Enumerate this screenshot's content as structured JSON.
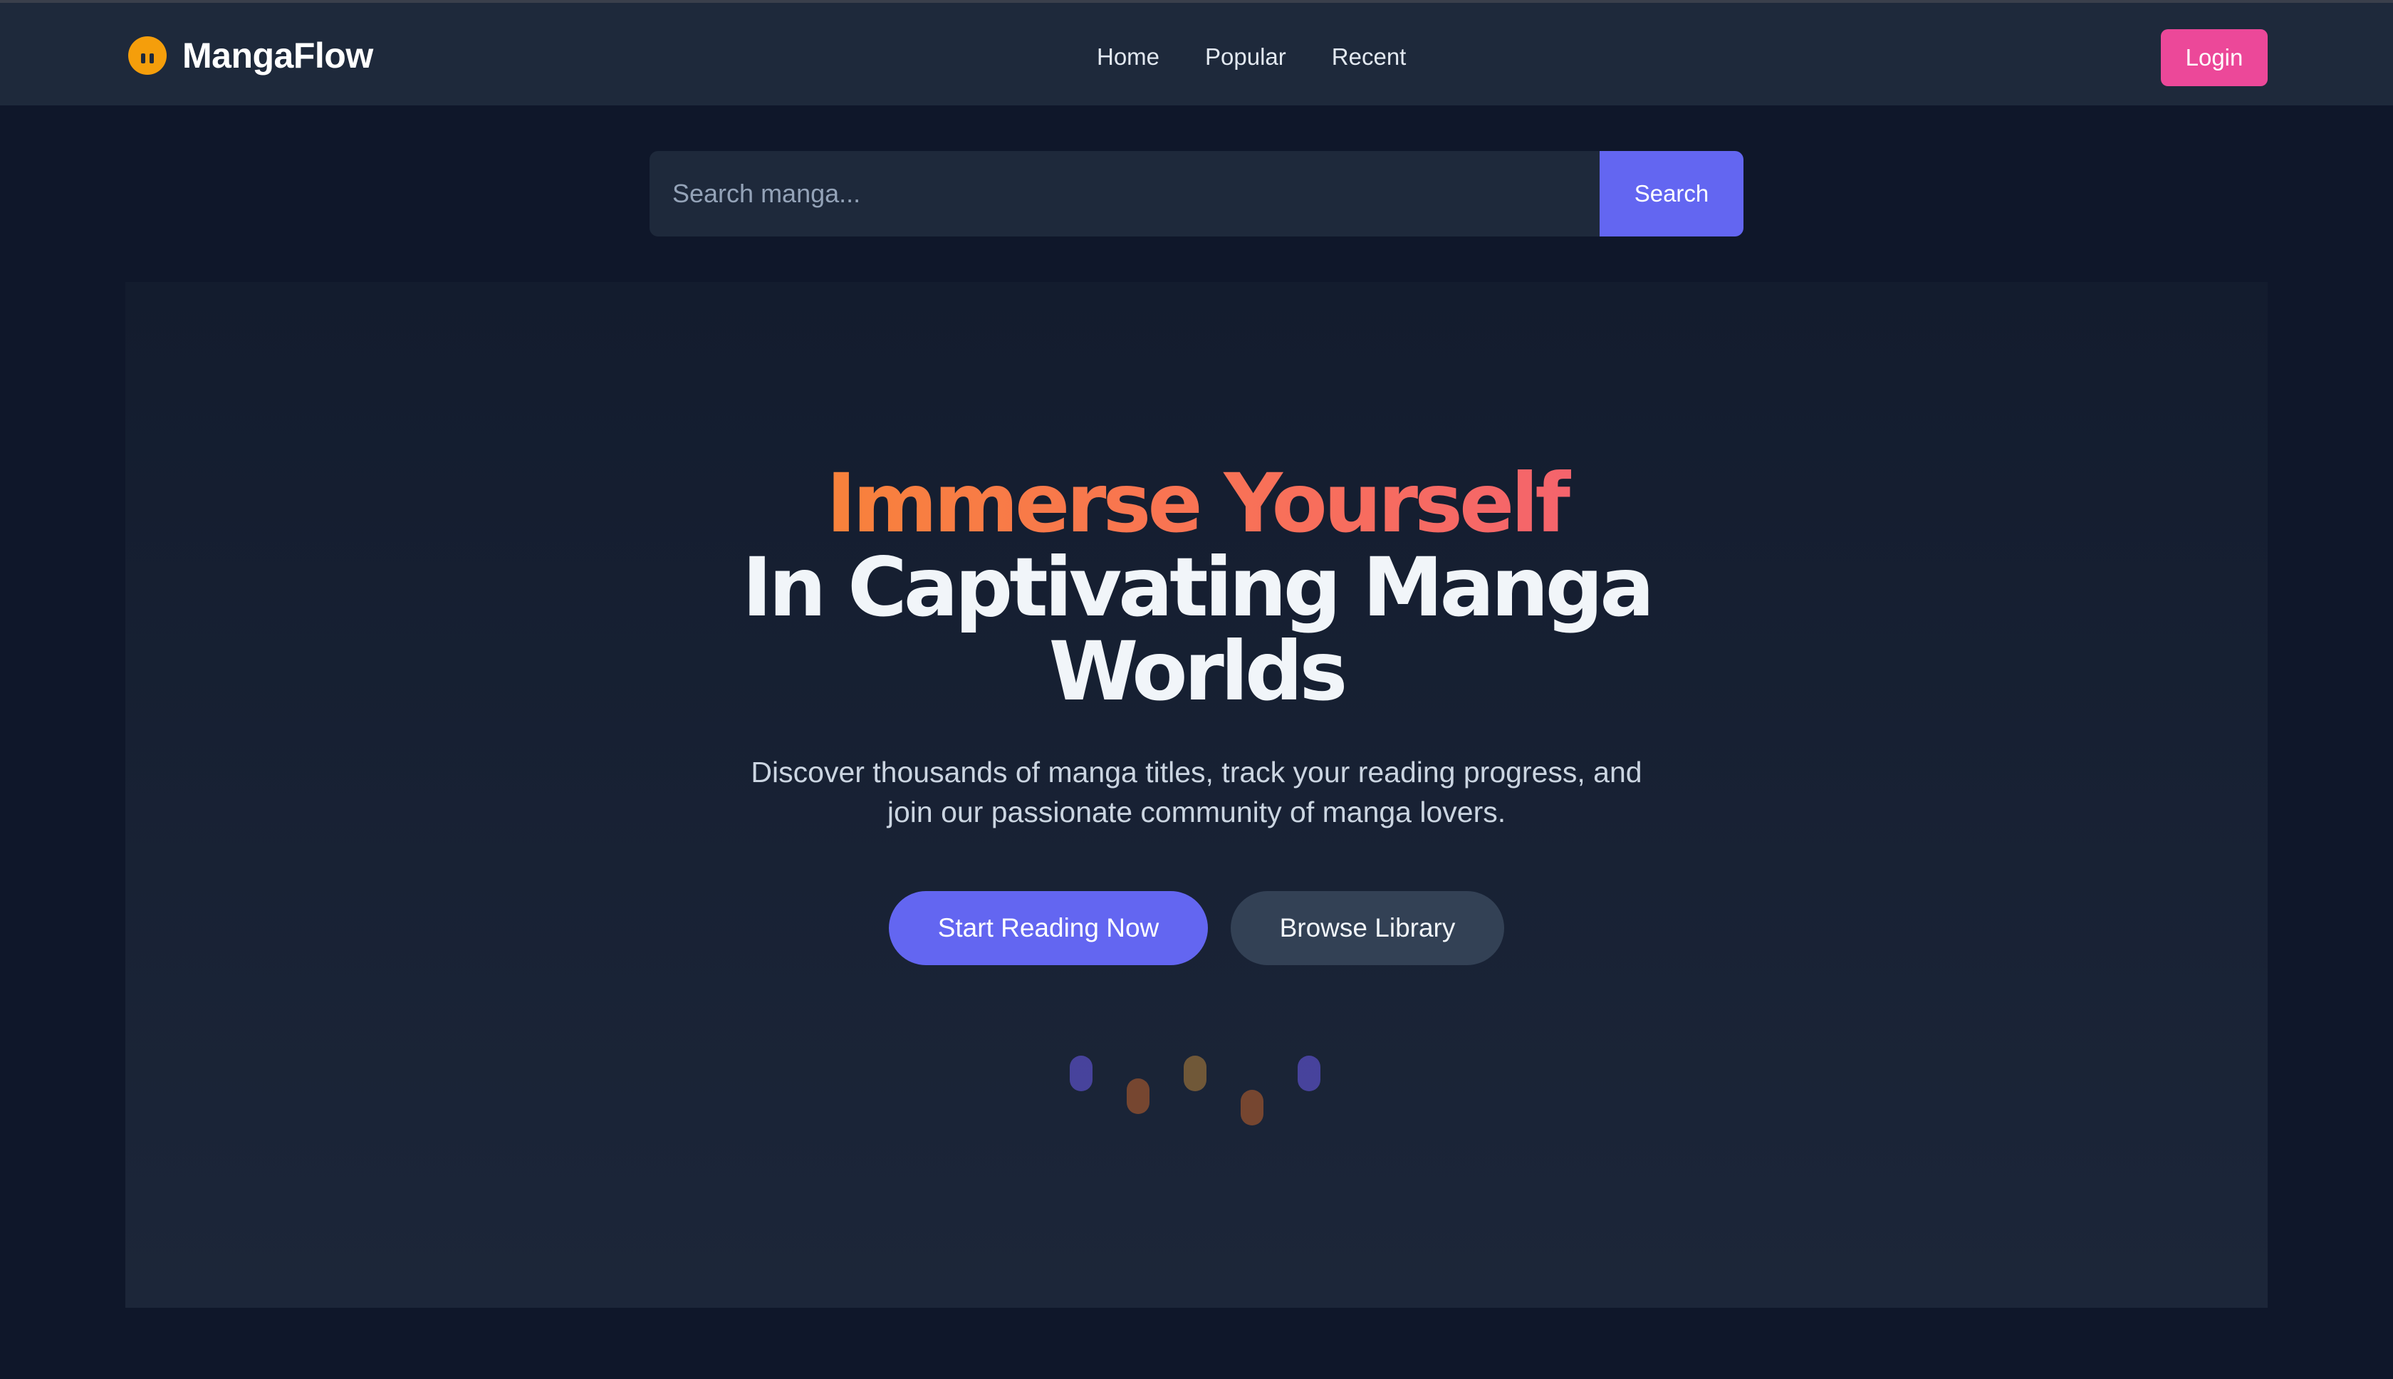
{
  "brand": {
    "name": "MangaFlow",
    "icon": "manga-logo-icon",
    "icon_color": "#f59e0b"
  },
  "nav": {
    "links": [
      {
        "label": "Home"
      },
      {
        "label": "Popular"
      },
      {
        "label": "Recent"
      }
    ],
    "login_label": "Login",
    "login_color": "#ec4899"
  },
  "search": {
    "placeholder": "Search manga...",
    "value": "",
    "button_label": "Search",
    "accent": "#6366f1"
  },
  "hero": {
    "title_line1": "Immerse Yourself",
    "title_line2": "In Captivating Manga",
    "title_line3": "Worlds",
    "description_line1": "Discover thousands of manga titles, track your reading progress, and",
    "description_line2": "join our passionate community of manga lovers.",
    "primary_cta": "Start Reading Now",
    "secondary_cta": "Browse Library"
  },
  "colors": {
    "background": "#0f172a",
    "navbar": "#1e293b",
    "gradient_start": "#f59e0b",
    "gradient_end": "#ec4899",
    "loader_purple": "#6d5cf0",
    "loader_orange": "#c2622c"
  }
}
